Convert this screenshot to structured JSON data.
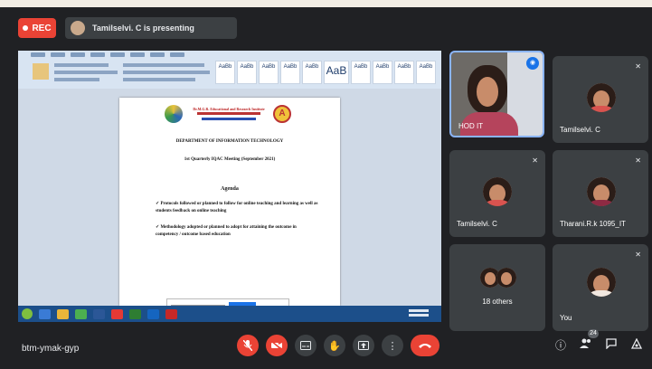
{
  "topbar": {
    "rec_label": "REC",
    "presenting_text": "Tamilselvi. C is presenting"
  },
  "document": {
    "org_name": "Dr.M.G.R. Educational and Research Institute",
    "department": "DEPARTMENT OF INFORMATION TECHNOLOGY",
    "meeting": "1st Quarterly IQAC Meeting (September 2021)",
    "agenda_title": "Agenda",
    "agenda_items": [
      "Protocols followed or planned to follow for online teaching and learning as well as students feedback on online teaching",
      "Methodology adopted or planned to adopt for attaining the outcome in competency / outcome based education"
    ]
  },
  "participants": [
    {
      "name": "HOD IT"
    },
    {
      "name": "Tamilselvi. C"
    },
    {
      "name": "Tamilselvi. C"
    },
    {
      "name": "Tharani.R.k 1095_IT"
    },
    {
      "name": "18 others"
    },
    {
      "name": "You"
    }
  ],
  "bottombar": {
    "meeting_code": "btm-ymak-gyp",
    "participant_count": "24"
  },
  "colors": {
    "background": "#202124",
    "tile": "#3c4043",
    "danger": "#ea4335",
    "accent": "#1a73e8"
  },
  "icons": [
    "mic-off-icon",
    "camera-off-icon",
    "captions-icon",
    "raise-hand-icon",
    "present-icon",
    "more-options-icon",
    "hang-up-icon",
    "info-icon",
    "people-icon",
    "chat-icon",
    "activities-icon"
  ]
}
